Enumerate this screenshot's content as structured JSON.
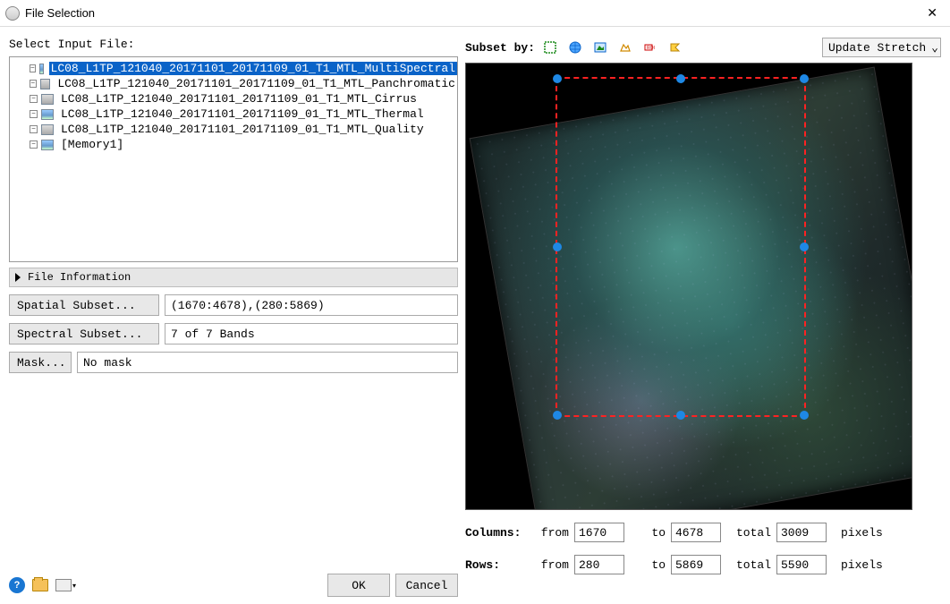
{
  "window": {
    "title": "File Selection"
  },
  "left": {
    "select_label": "Select Input File:",
    "files": [
      {
        "name": "LC08_L1TP_121040_20171101_20171109_01_T1_MTL_MultiSpectral",
        "icon": "color",
        "selected": true
      },
      {
        "name": "LC08_L1TP_121040_20171101_20171109_01_T1_MTL_Panchromatic",
        "icon": "gray"
      },
      {
        "name": "LC08_L1TP_121040_20171101_20171109_01_T1_MTL_Cirrus",
        "icon": "gray"
      },
      {
        "name": "LC08_L1TP_121040_20171101_20171109_01_T1_MTL_Thermal",
        "icon": "color"
      },
      {
        "name": "LC08_L1TP_121040_20171101_20171109_01_T1_MTL_Quality",
        "icon": "gray"
      },
      {
        "name": "[Memory1]",
        "icon": "color"
      }
    ],
    "file_info_label": "File Information",
    "spatial_btn": "Spatial Subset...",
    "spatial_val": "(1670:4678),(280:5869)",
    "spectral_btn": "Spectral Subset...",
    "spectral_val": "7 of 7 Bands",
    "mask_btn": "Mask...",
    "mask_val": "No mask",
    "ok": "OK",
    "cancel": "Cancel"
  },
  "right": {
    "subset_by": "Subset by:",
    "update_stretch": "Update Stretch",
    "columns_label": "Columns:",
    "rows_label": "Rows:",
    "from_label": "from",
    "to_label": "to",
    "total_label": "total",
    "pixels_label": "pixels",
    "cols": {
      "from": "1670",
      "to": "4678",
      "total": "3009"
    },
    "rows": {
      "from": "280",
      "to": "5869",
      "total": "5590"
    }
  }
}
